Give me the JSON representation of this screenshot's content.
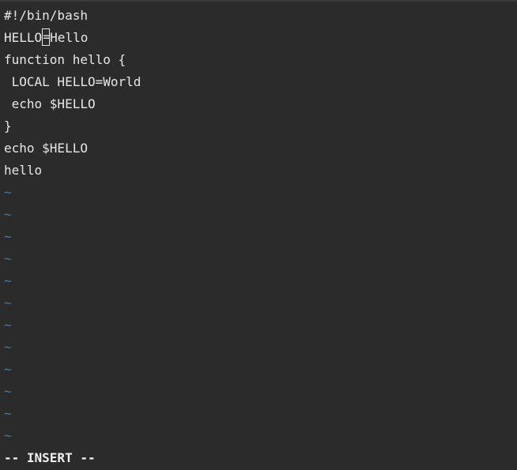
{
  "editor": {
    "lines": [
      "#!/bin/bash",
      "HELLO=Hello",
      "function hello {",
      " LOCAL HELLO=World",
      " echo $HELLO",
      "}",
      "echo $HELLO",
      "hello"
    ],
    "line2_before_cursor": "HELLO",
    "cursor_char": "=",
    "line2_after_cursor": "Hello",
    "empty_line_marker": "~",
    "empty_line_count": 12,
    "mode": "-- INSERT --"
  },
  "colors": {
    "background": "#2b2b2b",
    "text": "#e6e6e6",
    "tilde": "#3b7bb0"
  }
}
